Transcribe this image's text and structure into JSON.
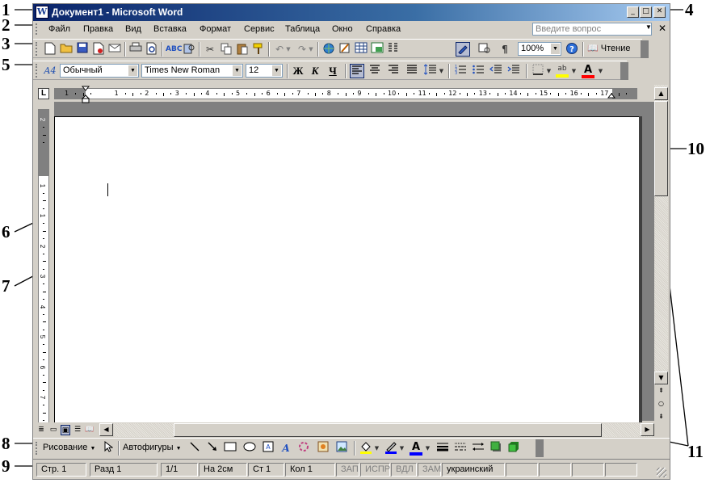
{
  "callouts": [
    "1",
    "2",
    "3",
    "4",
    "5",
    "6",
    "7",
    "8",
    "9",
    "10",
    "11"
  ],
  "window": {
    "title": "Документ1 - Microsoft Word",
    "app_icon": "W",
    "controls": {
      "minimize": "_",
      "maximize": "□",
      "close": "✕"
    }
  },
  "menu": {
    "items": [
      "Файл",
      "Правка",
      "Вид",
      "Вставка",
      "Формат",
      "Сервис",
      "Таблица",
      "Окно",
      "Справка"
    ],
    "ask_placeholder": "Введите вопрос",
    "close_doc": "✕"
  },
  "standard_toolbar": {
    "zoom": "100%",
    "read_button": "Чтение",
    "pilcrow": "¶"
  },
  "format_toolbar": {
    "style_icon": "A4",
    "style": "Обычный",
    "font": "Times New Roman",
    "size": "12",
    "bold": "Ж",
    "italic": "К",
    "underline": "Ч",
    "font_color_letter": "A",
    "highlight_label": "ab"
  },
  "ruler": {
    "tab_selector": "L",
    "h_numbers": [
      "1",
      "1",
      "2",
      "3",
      "4",
      "5",
      "6",
      "7",
      "8",
      "9",
      "10",
      "11",
      "12",
      "13",
      "14",
      "15",
      "16",
      "17"
    ],
    "v_numbers": [
      "2",
      "1",
      "1",
      "2",
      "3",
      "4",
      "5",
      "6",
      "7",
      "8"
    ]
  },
  "draw_toolbar": {
    "draw_menu": "Рисование",
    "autoshapes": "Автофигуры"
  },
  "statusbar": {
    "page": "Стр. 1",
    "section": "Разд 1",
    "pages": "1/1",
    "at": "На 2см",
    "line": "Ст 1",
    "col": "Кол 1",
    "rec": "ЗАП",
    "trk": "ИСПР",
    "ext": "ВДЛ",
    "ovr": "ЗАМ",
    "language": "украинский"
  },
  "colors": {
    "title_start": "#0a246a",
    "title_end": "#a6caf0",
    "face": "#d4d0c8",
    "shadow": "#808080",
    "highlight_color": "#ffff00",
    "font_color": "#ff0000",
    "line_color": "#0000ff"
  }
}
